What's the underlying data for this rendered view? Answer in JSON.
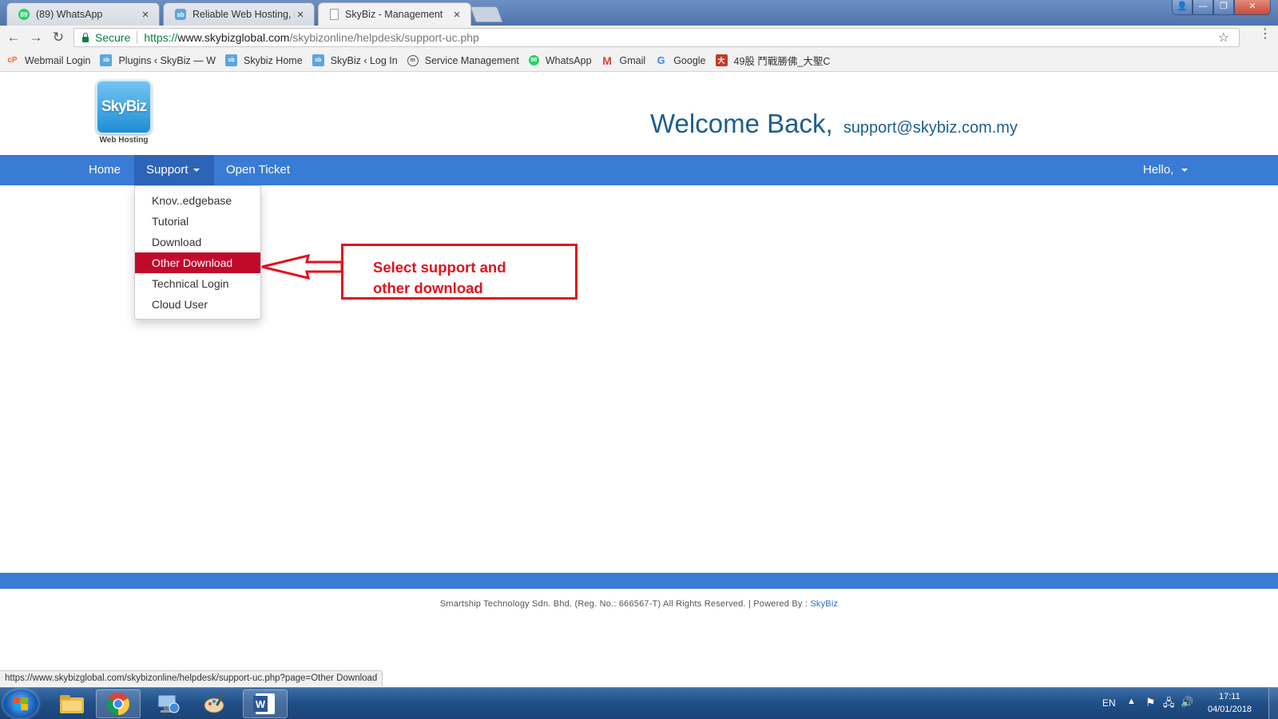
{
  "browser": {
    "tabs": [
      {
        "title": "(89) WhatsApp",
        "favicon": "whatsapp-icon",
        "badge": "89",
        "active": false
      },
      {
        "title": "Reliable Web Hosting, Pr",
        "favicon": "skybiz-icon",
        "active": false
      },
      {
        "title": "SkyBiz - Management",
        "favicon": "page-icon",
        "active": true
      }
    ],
    "secure_label": "Secure",
    "url_scheme": "https://",
    "url_host": "www.skybizglobal.com",
    "url_path": "/skybizonline/helpdesk/support-uc.php",
    "bookmarks": [
      {
        "label": "Webmail Login",
        "icon": "cpanel-icon"
      },
      {
        "label": "Plugins ‹ SkyBiz — W",
        "icon": "skybiz-icon"
      },
      {
        "label": "Skybiz Home",
        "icon": "skybiz-icon"
      },
      {
        "label": "SkyBiz ‹ Log In",
        "icon": "skybiz-icon"
      },
      {
        "label": "Service Management",
        "icon": "service-icon"
      },
      {
        "label": "WhatsApp",
        "icon": "whatsapp-icon"
      },
      {
        "label": "Gmail",
        "icon": "gmail-icon"
      },
      {
        "label": "Google",
        "icon": "google-icon"
      },
      {
        "label": "49股 鬥戰勝佛_大聖C",
        "icon": "site-icon"
      }
    ],
    "status_url": "https://www.skybizglobal.com/skybizonline/helpdesk/support-uc.php?page=Other Download"
  },
  "header": {
    "logo_text": "SkyBiz",
    "logo_sub": "Web Hosting",
    "welcome": "Welcome Back,",
    "email": "support@skybiz.com.my"
  },
  "nav": {
    "home": "Home",
    "support": "Support",
    "open_ticket": "Open Ticket",
    "hello": "Hello,"
  },
  "dropdown": {
    "items": [
      "Knov..edgebase",
      "Tutorial",
      "Download",
      "Other Download",
      "Technical Login",
      "Cloud User"
    ],
    "active_index": 3
  },
  "annotation": {
    "line1": "Select support and",
    "line2": "other download"
  },
  "footer": {
    "text": "Smartship Technology Sdn. Bhd. (Reg. No.: 666567-T) All Rights Reserved. | Powered By : ",
    "brand": "SkyBiz"
  },
  "taskbar": {
    "lang": "EN",
    "time": "17:11",
    "date": "04/01/2018",
    "apps": [
      "start-orb",
      "file-explorer-icon",
      "chrome-icon",
      "network-icon",
      "paint-icon",
      "word-icon"
    ]
  },
  "colors": {
    "navbar": "#3a7bd5",
    "dropdown_active": "#c1092c",
    "welcome": "#1d5e8e",
    "annotation": "#e0131d"
  }
}
